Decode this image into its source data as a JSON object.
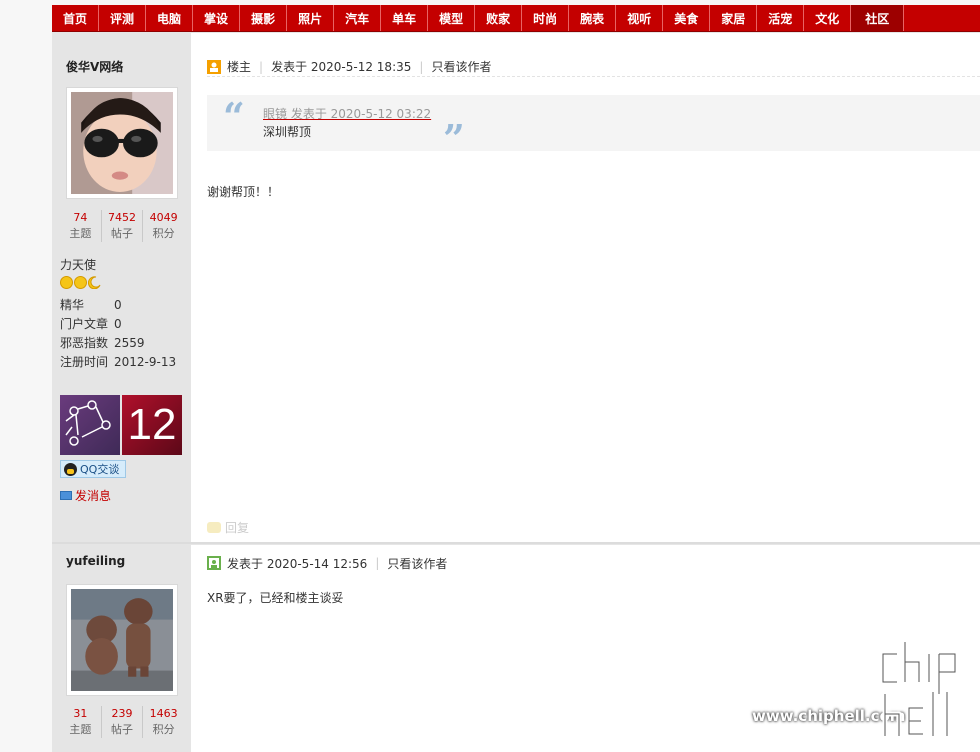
{
  "nav": {
    "items": [
      "首页",
      "评测",
      "电脑",
      "掌设",
      "摄影",
      "照片",
      "汽车",
      "单车",
      "模型",
      "败家",
      "时尚",
      "腕表",
      "视听",
      "美食",
      "家居",
      "活宠",
      "文化",
      "社区"
    ],
    "active_index": 17,
    "color": "#c40000"
  },
  "post1": {
    "username": "俊华V网络",
    "stats": [
      {
        "value": "74",
        "label": "主题"
      },
      {
        "value": "7452",
        "label": "帖子"
      },
      {
        "value": "4049",
        "label": "积分"
      }
    ],
    "group": "力天使",
    "info": [
      {
        "key": "精华",
        "value": "0"
      },
      {
        "key": "门户文章",
        "value": "0"
      },
      {
        "key": "邪恶指数",
        "value": "2559"
      },
      {
        "key": "注册时间",
        "value": "2012-9-13"
      }
    ],
    "medal_number": "12",
    "qq_label": "QQ交谈",
    "message_label": "发消息",
    "role": "楼主",
    "posted": "发表于 2020-5-12 18:35",
    "author_only": "只看该作者",
    "quote": {
      "meta": "眼镜 发表于 2020-5-12 03:22",
      "text": "深圳帮顶"
    },
    "body": "谢谢帮顶！！",
    "reply_label": "回复",
    "top_reply_label": "回复"
  },
  "post2": {
    "username": "yufeiling",
    "stats": [
      {
        "value": "31",
        "label": "主题"
      },
      {
        "value": "239",
        "label": "帖子"
      },
      {
        "value": "1463",
        "label": "积分"
      }
    ],
    "posted": "发表于 2020-5-14 12:56",
    "author_only": "只看该作者",
    "body": "XR要了，已经和楼主谈妥"
  },
  "watermark": {
    "url": "www.chiphell.com",
    "logo_text": "chiphell"
  }
}
